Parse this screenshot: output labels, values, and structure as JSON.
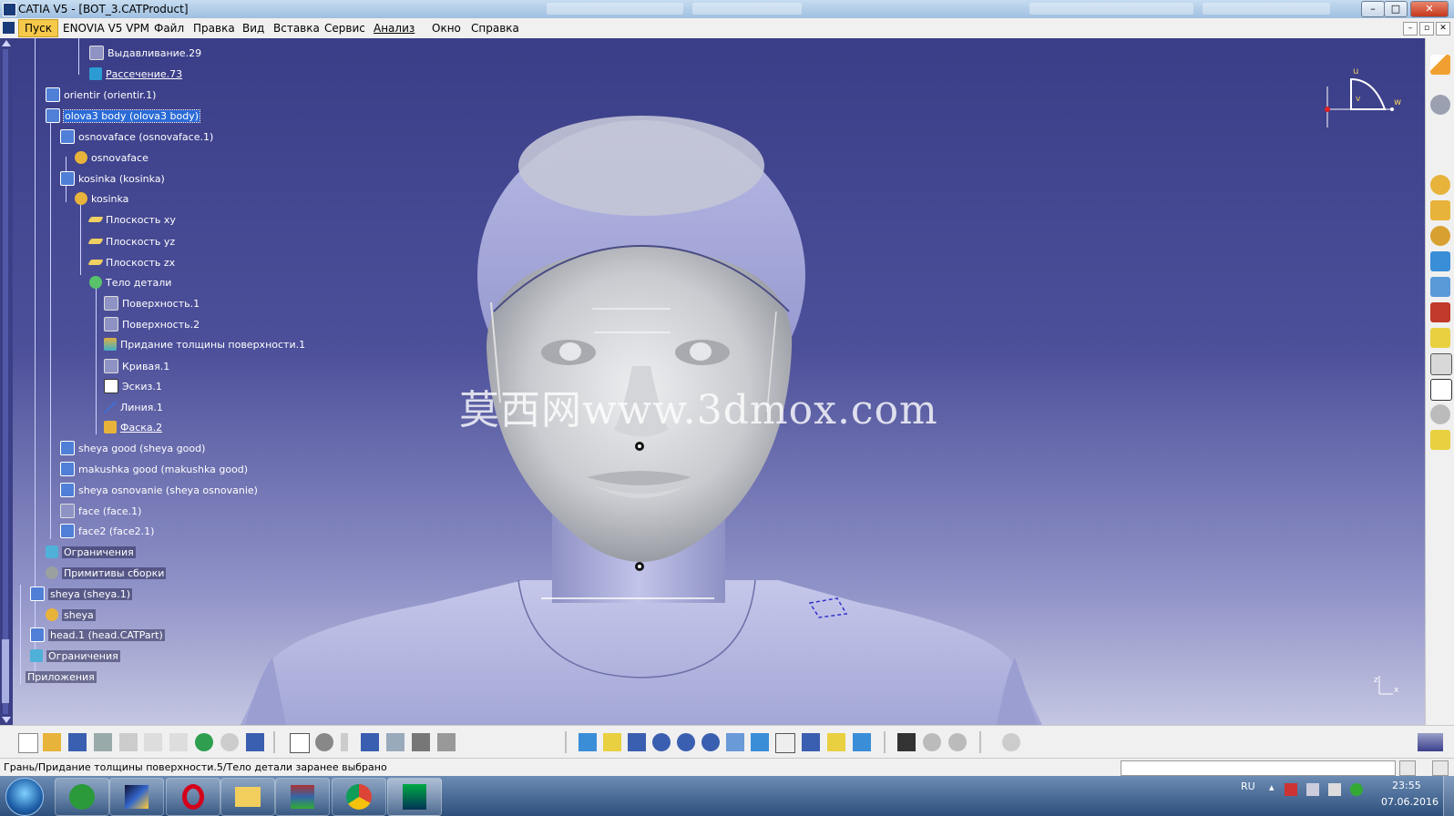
{
  "window": {
    "title": "CATIA V5 - [BOT_3.CATProduct]",
    "buttons": {
      "minimize": "–",
      "maximize": "□",
      "close": "✕"
    }
  },
  "menu": {
    "items": [
      "Пуск",
      "ENOVIA V5 VPM",
      "Файл",
      "Правка",
      "Вид",
      "Вставка",
      "Сервис",
      "Анализ",
      "Окно",
      "Справка"
    ],
    "mdi": [
      "–",
      "▫",
      "✕"
    ]
  },
  "tree": {
    "nodes": [
      {
        "label": "Выдавливание.29",
        "icon": "extrude-icon",
        "color": "#8f93c4"
      },
      {
        "label": "Рассечение.73",
        "icon": "split-icon",
        "color": "#2c9bd4"
      },
      {
        "label": "orientir (orientir.1)",
        "icon": "part-icon",
        "color": "#4f7fd6"
      },
      {
        "label": "olova3 body (olova3 body)",
        "icon": "part-icon",
        "color": "#4f7fd6"
      },
      {
        "label": "osnovaface (osnovaface.1)",
        "icon": "part-icon",
        "color": "#4f7fd6"
      },
      {
        "label": "osnovaface",
        "icon": "gear-part-icon",
        "color": "#e8b33a"
      },
      {
        "label": "kosinka (kosinka)",
        "icon": "part-icon",
        "color": "#4f7fd6"
      },
      {
        "label": "kosinka",
        "icon": "gear-part-icon",
        "color": "#e8b33a"
      },
      {
        "label": "Плоскость xy",
        "icon": "plane-icon",
        "color": "#f0d060"
      },
      {
        "label": "Плоскость yz",
        "icon": "plane-icon",
        "color": "#f0d060"
      },
      {
        "label": "Плоскость zx",
        "icon": "plane-icon",
        "color": "#f0d060"
      },
      {
        "label": "Тело детали",
        "icon": "body-gear-icon",
        "color": "#58c36a"
      },
      {
        "label": "Поверхность.1",
        "icon": "surface-icon",
        "color": "#8f93c4"
      },
      {
        "label": "Поверхность.2",
        "icon": "surface-icon",
        "color": "#8f93c4"
      },
      {
        "label": "Придание толщины поверхности.1",
        "icon": "thicken-icon",
        "color": "#e0b040"
      },
      {
        "label": "Кривая.1",
        "icon": "curve-icon",
        "color": "#8f93c4"
      },
      {
        "label": "Эскиз.1",
        "icon": "sketch-icon",
        "color": "#ffffff"
      },
      {
        "label": "Линия.1",
        "icon": "line-icon",
        "color": "#3d6fd8"
      },
      {
        "label": "Фаска.2",
        "icon": "chamfer-icon",
        "color": "#e8b33a"
      },
      {
        "label": "sheya good (sheya good)",
        "icon": "part-icon",
        "color": "#4f7fd6"
      },
      {
        "label": "makushka good (makushka good)",
        "icon": "part-icon",
        "color": "#4f7fd6"
      },
      {
        "label": "sheya osnovanie (sheya osnovanie)",
        "icon": "part-icon",
        "color": "#4f7fd6"
      },
      {
        "label": "face (face.1)",
        "icon": "part-icon",
        "color": "#8f93c4"
      },
      {
        "label": "face2 (face2.1)",
        "icon": "part-icon",
        "color": "#4f7fd6"
      },
      {
        "label": "Ограничения",
        "icon": "constraints-icon",
        "color": "#4fb0d8"
      },
      {
        "label": "Примитивы сборки",
        "icon": "assembly-features-icon",
        "color": "#9aa0a0"
      },
      {
        "label": "sheya (sheya.1)",
        "icon": "part-icon",
        "color": "#4f7fd6"
      },
      {
        "label": "sheya",
        "icon": "gear-part-icon",
        "color": "#e8b33a"
      },
      {
        "label": "head.1 (head.CATPart)",
        "icon": "part-icon",
        "color": "#4f7fd6"
      },
      {
        "label": "Ограничения",
        "icon": "constraints-icon",
        "color": "#4fb0d8"
      },
      {
        "label": "Приложения",
        "icon": "",
        "color": ""
      }
    ]
  },
  "viewport": {
    "watermark": "莫西网www.3dmox.com",
    "compass_labels": {
      "u": "u",
      "v": "v",
      "w": "w"
    },
    "axis_labels": {
      "z": "z",
      "x": "x"
    }
  },
  "status": {
    "text": "Грань/Придание толщины поверхности.5/Тело детали заранее выбрано"
  },
  "taskbar": {
    "language": "RU",
    "time": "23:55",
    "date": "07.06.2016"
  },
  "colors": {
    "viewport_top": "#3a3d87",
    "model_lavender": "#a9abdc",
    "selection": "#2b6bd6"
  }
}
